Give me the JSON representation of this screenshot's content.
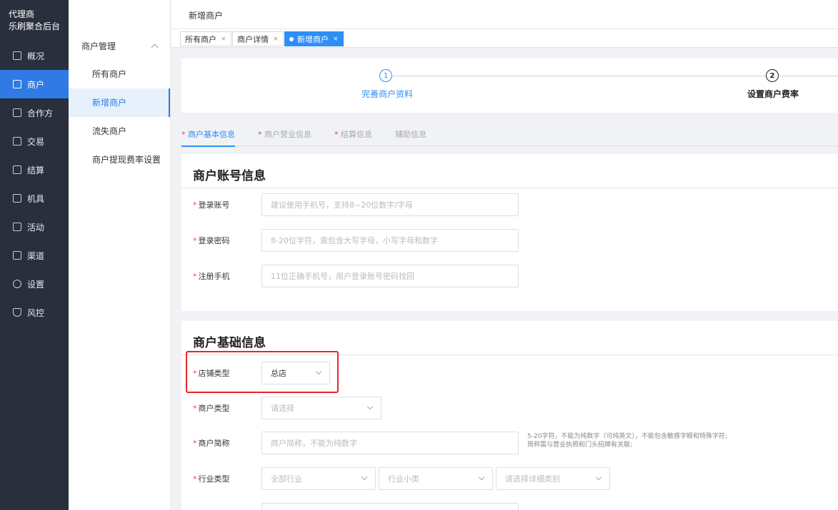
{
  "sidebar": {
    "brand_line1": "代理商",
    "brand_line2": "乐刷聚合后台",
    "items": [
      {
        "label": "概况",
        "icon": "dashboard-icon"
      },
      {
        "label": "商户",
        "icon": "merchant-icon"
      },
      {
        "label": "合作方",
        "icon": "partner-icon"
      },
      {
        "label": "交易",
        "icon": "transaction-icon"
      },
      {
        "label": "结算",
        "icon": "settlement-icon"
      },
      {
        "label": "机具",
        "icon": "device-icon"
      },
      {
        "label": "活动",
        "icon": "activity-icon"
      },
      {
        "label": "渠道",
        "icon": "channel-icon"
      },
      {
        "label": "设置",
        "icon": "settings-icon"
      },
      {
        "label": "风控",
        "icon": "risk-shield-icon"
      }
    ],
    "active_color": "#2f7ae5"
  },
  "submenu": {
    "group_label": "商户管理",
    "items": [
      {
        "label": "所有商户"
      },
      {
        "label": "新增商户"
      },
      {
        "label": "流失商户"
      },
      {
        "label": "商户提现费率设置"
      }
    ]
  },
  "header": {
    "title": "新增商户"
  },
  "tabs": [
    {
      "label": "所有商户"
    },
    {
      "label": "商户详情"
    },
    {
      "label": "新增商户"
    }
  ],
  "steps": [
    {
      "number": "1",
      "label": "完善商户资料"
    },
    {
      "number": "2",
      "label": "设置商户费率"
    }
  ],
  "form_tabs": [
    {
      "required": "*",
      "label": "商户基本信息"
    },
    {
      "required": "*",
      "label": "商户营业信息"
    },
    {
      "required": "*",
      "label": "结算信息"
    },
    {
      "required": "",
      "label": "辅助信息"
    }
  ],
  "account_section": {
    "title": "商户账号信息",
    "fields": [
      {
        "label": "登录账号",
        "placeholder": "建议使用手机号，支持8~20位数字/字母"
      },
      {
        "label": "登录密码",
        "placeholder": "8-20位字符，需包含大写字母，小写字母和数字"
      },
      {
        "label": "注册手机",
        "placeholder": "11位正确手机号，用户登录账号密码找回"
      }
    ]
  },
  "basic_section": {
    "title": "商户基础信息",
    "store_type": {
      "label": "店铺类型",
      "value": "总店"
    },
    "merchant_type": {
      "label": "商户类型",
      "placeholder": "请选择"
    },
    "short_name": {
      "label": "商户简称",
      "placeholder": "商户简称，不能为纯数字",
      "hint_line1": "5-20字符，不能为纯数字（可纯英文），不能包含敏感字眼和特殊字符;",
      "hint_line2": "简称需与营业执照和门头招牌有关联;"
    },
    "industry": {
      "label": "行业类型",
      "select1": "全部行业",
      "select2": "行业小类",
      "select3": "请选择详细类别"
    }
  },
  "required_mark": "*",
  "close_mark": "×"
}
